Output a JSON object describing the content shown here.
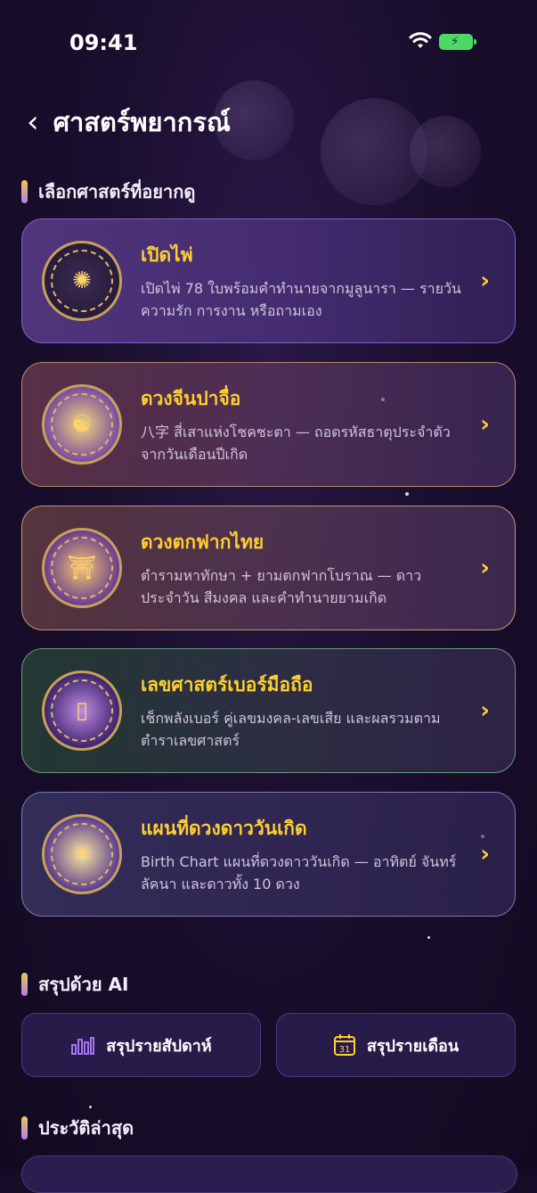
{
  "status_bar": {
    "time": "09:41"
  },
  "header": {
    "title": "ศาสตร์พยากรณ์"
  },
  "sections": {
    "choose": "เลือกศาสตร์ที่อยากดู",
    "ai": "สรุปด้วย AI",
    "history": "ประวัติล่าสุด"
  },
  "cards": [
    {
      "title": "เปิดไพ่",
      "desc": "เปิดไพ่ 78 ใบพร้อมคำทำนายจากมูลูนารา — รายวัน ความรัก การงาน หรือถามเอง",
      "icon": "tarot-wheel-icon"
    },
    {
      "title": "ดวงจีนปาจื่อ",
      "desc": "八字 สี่เสาแห่งโชคชะตา — ถอดรหัสธาตุประจำตัว จากวันเดือนปีเกิด",
      "icon": "bazi-dragon-icon"
    },
    {
      "title": "ดวงตกฟากไทย",
      "desc": "ตำรามหาทักษา + ยามตกฟากโบราณ — ดาว ประจำวัน สีมงคล และคำทำนายยามเกิด",
      "icon": "thai-temple-icon"
    },
    {
      "title": "เลขศาสตร์เบอร์มือถือ",
      "desc": "เช็กพลังเบอร์ คู่เลขมงคล-เลขเสีย และผลรวมตาม ตำราเลขศาสตร์",
      "icon": "phone-numerology-icon"
    },
    {
      "title": "แผนที่ดวงดาววันเกิด",
      "desc": "Birth Chart แผนที่ดวงดาววันเกิด — อาทิตย์ จันทร์ ลัคนา และดาวทั้ง 10 ดวง",
      "icon": "zodiac-wheel-icon"
    }
  ],
  "buttons": {
    "weekly": "สรุปรายสัปดาห์",
    "monthly": "สรุปรายเดือน",
    "weekly_icon": "bar-chart-icon",
    "monthly_icon": "calendar-icon",
    "calendar_day": "31"
  },
  "colors": {
    "accent": "#ffcf2e",
    "background": "#1a0f2e"
  }
}
